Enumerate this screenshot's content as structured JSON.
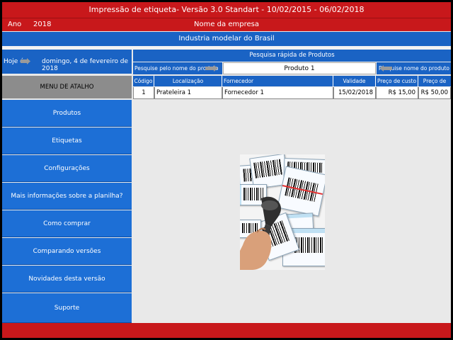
{
  "header": {
    "title": "Impressão de etiqueta- Versão 3.0 Standart - 10/02/2015 - 06/02/2018",
    "year_label": "Ano",
    "year_value": "2018",
    "company_label": "Nome da empresa",
    "company_name": "Industria modelar do Brasil"
  },
  "today": {
    "label": "Hoje é",
    "date": "domingo, 4 de fevereiro de 2018"
  },
  "menu": {
    "title": "MENU DE ATALHO",
    "items": [
      "Produtos",
      "Etiquetas",
      "Configurações",
      "Mais informações sobre a planilha?",
      "Como comprar",
      "Comparando versões",
      "Novidades desta versão",
      "Suporte"
    ]
  },
  "search": {
    "title": "Pesquisa rápida de Produtos",
    "left_label": "Pesquise pelo nome do produto",
    "value": "Produto 1",
    "right_label": "Pesquise nome do produto"
  },
  "table": {
    "columns": [
      "Código",
      "Localização",
      "Fornecedor",
      "Validade",
      "Preço de custo",
      "Preço de venda"
    ],
    "rows": [
      [
        "1",
        "Prateleira 1",
        "Fornecedor 1",
        "15/02/2018",
        "R$ 15,00",
        "R$ 50,00"
      ]
    ]
  },
  "colors": {
    "header_red": "#c8181b",
    "menu_blue": "#1d6fd6",
    "menu_head_gray": "#8c8c8c"
  },
  "image": {
    "description_icon": "barcode-scanner-image"
  }
}
